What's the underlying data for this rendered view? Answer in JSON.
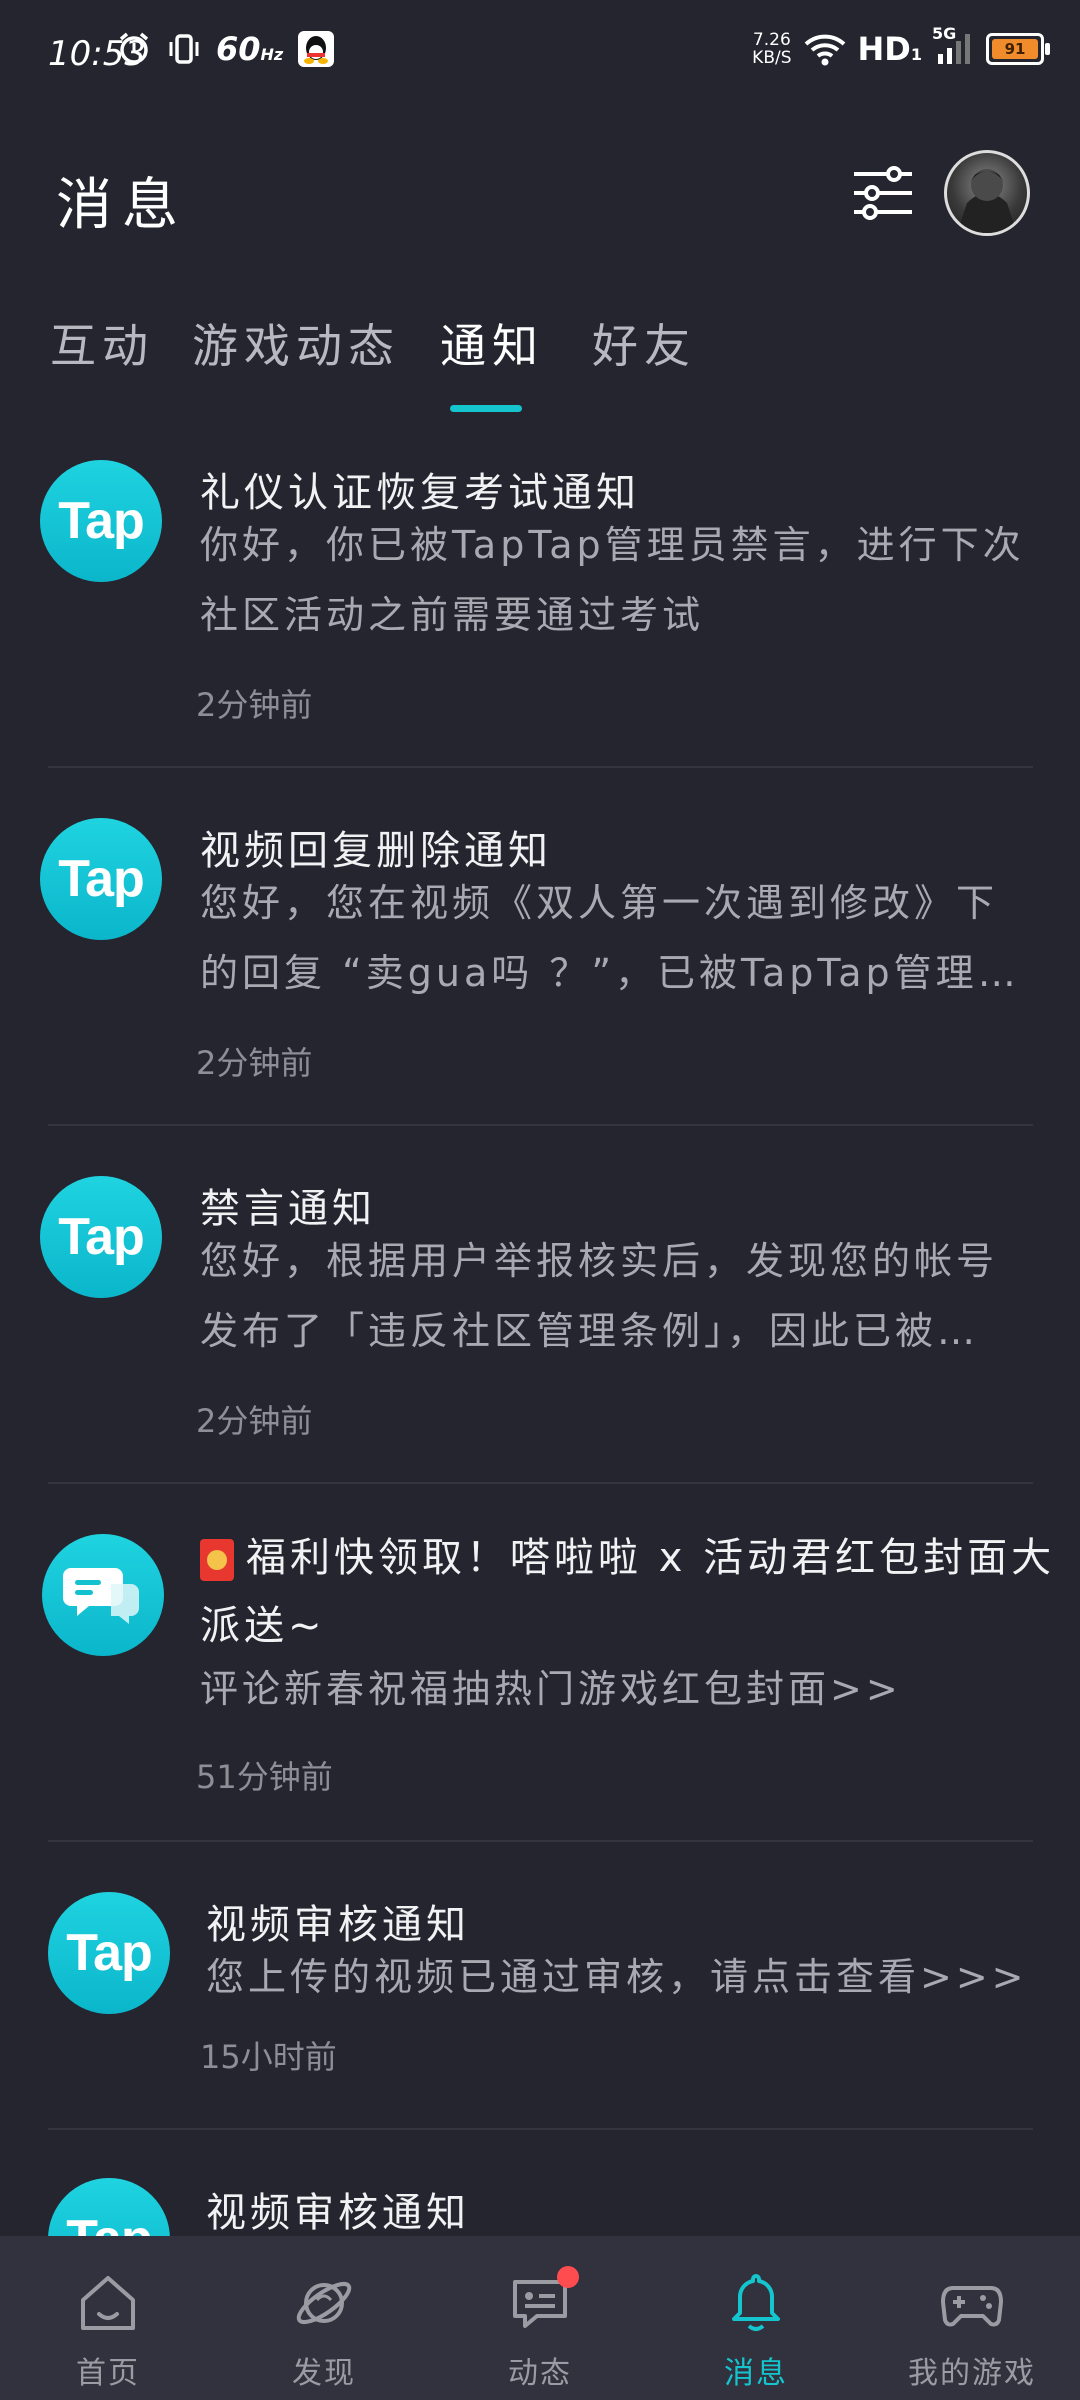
{
  "status_bar": {
    "time": "10:53",
    "refresh_rate": "60",
    "refresh_unit": "Hz",
    "net_speed_value": "7.26",
    "net_speed_unit": "KB/S",
    "hd_label": "HD",
    "hd_sub": "1",
    "network": "5G",
    "battery": "91"
  },
  "header": {
    "title": "消息"
  },
  "tabs": [
    {
      "label": "互动"
    },
    {
      "label": "游戏动态"
    },
    {
      "label": "通知"
    },
    {
      "label": "好友"
    }
  ],
  "active_tab": "通知",
  "notifications": [
    {
      "icon": "tap-logo",
      "logo_text": "Tap",
      "title": "礼仪认证恢复考试通知",
      "body": "你好，你已被TapTap管理员禁言，进行下次社区活动之前需要通过考试",
      "time": "2分钟前"
    },
    {
      "icon": "tap-logo",
      "logo_text": "Tap",
      "title": "视频回复删除通知",
      "body": "您好，您在视频《双人第一次遇到修改》下的回复 “卖gua吗 ？”，已被TapTap管理员…",
      "time": "2分钟前"
    },
    {
      "icon": "tap-logo",
      "logo_text": "Tap",
      "title": "禁言通知",
      "body": "您好，根据用户举报核实后，发现您的帐号发布了「违反社区管理条例」，因此已被…",
      "time": "2分钟前"
    },
    {
      "icon": "chat-bubble-logo",
      "title_line1": "福利快领取！嗒啦啦 x 活动君红包封面大",
      "title_line2": "派送~",
      "body": "评论新春祝福抽热门游戏红包封面>>",
      "time": "51分钟前"
    },
    {
      "icon": "tap-logo",
      "logo_text": "Tap",
      "title": "视频审核通知",
      "body": "您上传的视频已通过审核，请点击查看>>>",
      "time": "15小时前"
    },
    {
      "icon": "tap-logo",
      "logo_text": "Tap",
      "title": "视频审核通知"
    }
  ],
  "bottom_nav": [
    {
      "label": "首页",
      "icon": "home-icon"
    },
    {
      "label": "发现",
      "icon": "planet-icon"
    },
    {
      "label": "动态",
      "icon": "feed-icon",
      "badge": true
    },
    {
      "label": "消息",
      "icon": "bell-icon",
      "active": true
    },
    {
      "label": "我的游戏",
      "icon": "gamepad-icon"
    }
  ],
  "colors": {
    "background": "#24252f",
    "accent": "#15c5ce",
    "nav_background": "#31323d",
    "badge": "#ff4d4f"
  }
}
